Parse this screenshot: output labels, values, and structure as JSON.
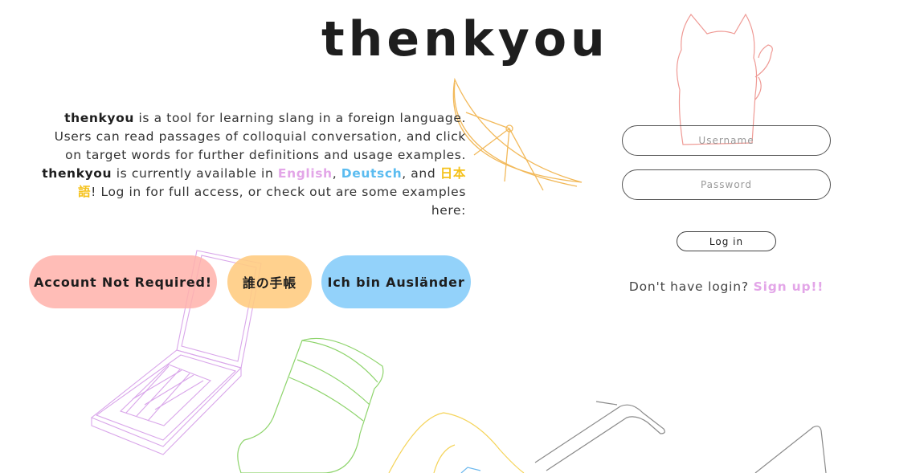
{
  "logo": "thenkyou",
  "intro": {
    "brand": "thenkyou",
    "text_1": " is a tool for learning slang in a foreign language. Users can read passages of colloquial conversation, and click on target words for further definitions and usage examples. ",
    "text_2": " is currently available in ",
    "lang_en": "English",
    "sep_1": ", ",
    "lang_de": "Deutsch",
    "sep_2": ", and ",
    "lang_ja": "日本語",
    "text_3": "! Log in for full access, or check out are some examples here:"
  },
  "examples": {
    "english": "Account Not Required!",
    "japanese": "誰の手帳",
    "german": "Ich bin Ausländer"
  },
  "login": {
    "username_placeholder": "Username",
    "password_placeholder": "Password",
    "button": "Log in",
    "signup_prompt": "Don't have login? ",
    "signup_link": "Sign up!!"
  },
  "colors": {
    "pink": "#e3a6e8",
    "blue": "#5bbcf0",
    "yellow": "#f5c21b",
    "salmon": "#ffb1aa",
    "peach": "#ffcc82",
    "sky": "#87cdfa"
  },
  "decorations": [
    "lemon-slice-icon",
    "cat-icon",
    "flip-phone-icon",
    "sock-icon",
    "sunglasses-icon",
    "banana-icon"
  ]
}
